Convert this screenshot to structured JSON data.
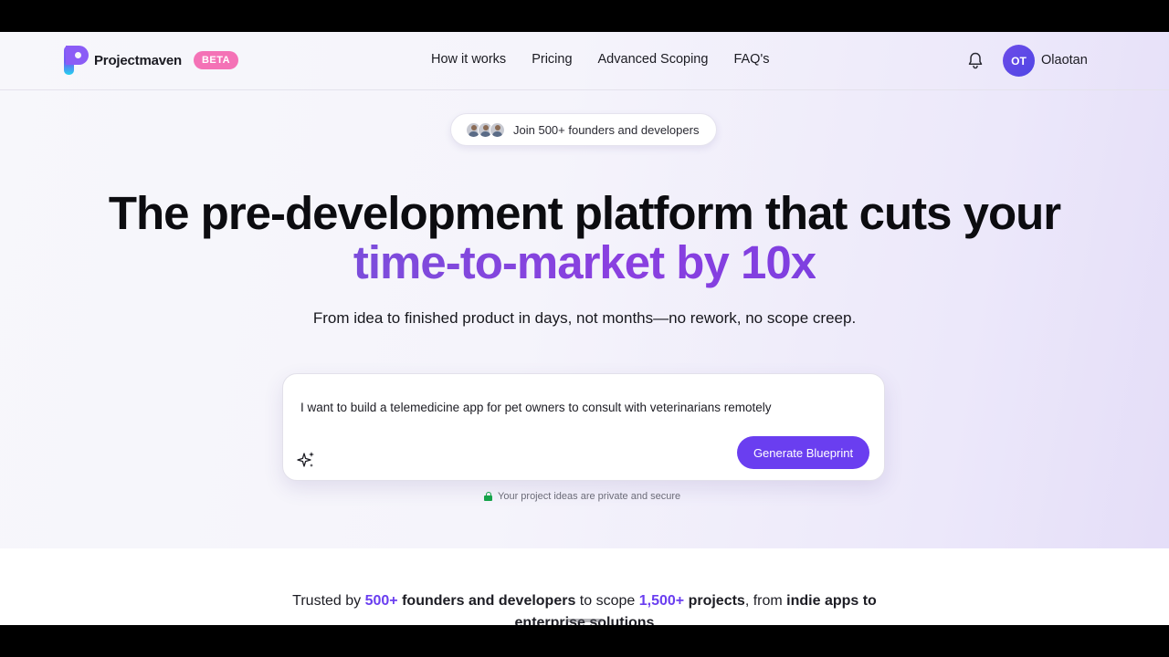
{
  "brand": {
    "name": "Projectmaven",
    "badge": "BETA"
  },
  "nav": {
    "items": [
      "How it works",
      "Pricing",
      "Advanced Scoping",
      "FAQ's"
    ]
  },
  "user": {
    "initials": "OT",
    "name": "Olaotan"
  },
  "social_proof": {
    "text": "Join 500+ founders and developers"
  },
  "hero": {
    "title_line1": "The pre-development platform that cuts your",
    "title_line2": "time-to-market by 10x",
    "subtitle": "From idea to finished product in days, not months—no rework, no scope creep."
  },
  "prompt": {
    "value": "I want to build a telemedicine app for pet owners to consult with veterinarians remotely",
    "button_label": "Generate Blueprint",
    "privacy_note": "Your project ideas are private and secure"
  },
  "trusted": {
    "t1": "Trusted by ",
    "n1": "500+",
    "t2": " founders and developers",
    "t3": " to scope ",
    "n2": "1,500+",
    "t4": " projects",
    "t5": ", from ",
    "t6": "indie apps to enterprise solutions"
  },
  "colors": {
    "accent": "#6a3ef0",
    "badge": "#f472b6",
    "secure": "#16a34a"
  },
  "icons": {
    "notifications": "bell-icon",
    "ai": "sparkle-icon",
    "privacy": "lock-icon"
  }
}
